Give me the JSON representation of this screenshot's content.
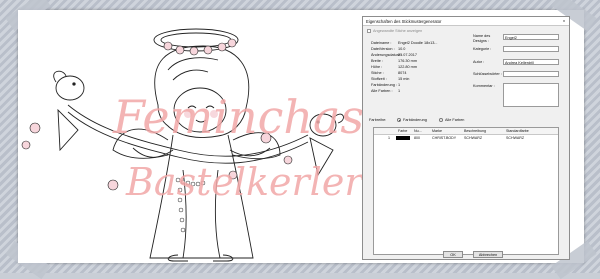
{
  "dialog": {
    "title": "Eigenschaften des Stickmustergenerator",
    "close_label": "x",
    "checkbox_label": "Angewandte Stiche anzeigen",
    "info": [
      {
        "label": "Dateiname :",
        "value": "Engel2 Doodle 18x13..."
      },
      {
        "label": "DateiVersion :",
        "value": "10.0"
      },
      {
        "label": "Änderungsdatum :",
        "value": "25.07.2017"
      },
      {
        "label": "Breite :",
        "value": "176.30 mm"
      },
      {
        "label": "Höhe :",
        "value": "122.80 mm"
      },
      {
        "label": "Stiche :",
        "value": "8074"
      },
      {
        "label": "Stoffzeit :",
        "value": "15 min"
      },
      {
        "label": "Farbänderung :",
        "value": "1"
      },
      {
        "label": "Alle Farben :",
        "value": "1"
      }
    ],
    "name_label": "Name des Designs :",
    "name_value": "Engel2",
    "category_label": "Kategorie :",
    "category_value": "",
    "author_label": "Autor :",
    "author_value": "Andrea Kellerdrill",
    "keywords_label": "Schlüsselwörter :",
    "keywords_value": "",
    "comments_label": "Kommentar :",
    "farbreihe_label": "Farbreihe:",
    "radio1_label": "Farbänderung",
    "radio2_label": "Alle Farben",
    "table": {
      "headers": [
        "Farbe",
        "Nu...",
        "Marke",
        "Beschreibung",
        "Standardfarbe"
      ],
      "rows": [
        {
          "index": "1",
          "number": "800",
          "brand": "CHRIST.BODY",
          "description": "SCHWARZ",
          "standard": "SCHWARZ"
        }
      ]
    },
    "ok_label": "OK",
    "cancel_label": "Abbrechen"
  },
  "watermark": {
    "line1": "Feminchas",
    "line2": "Bastelkerler"
  }
}
